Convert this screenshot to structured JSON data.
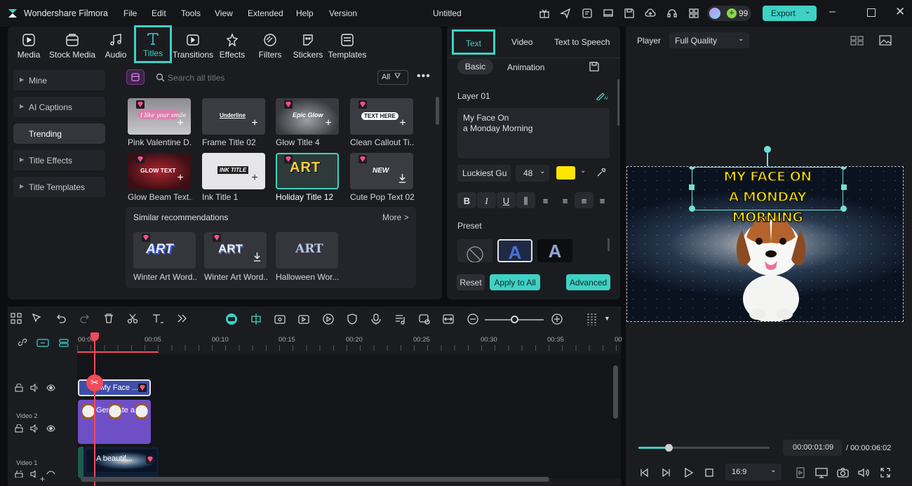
{
  "app": {
    "name": "Wondershare Filmora",
    "doc_title": "Untitled",
    "credits": "99",
    "export_label": "Export"
  },
  "menu": [
    "File",
    "Edit",
    "Tools",
    "View",
    "Extended",
    "Help",
    "Version"
  ],
  "toolbar": [
    "Media",
    "Stock Media",
    "Audio",
    "Titles",
    "Transitions",
    "Effects",
    "Filters",
    "Stickers",
    "Templates"
  ],
  "sidebar": [
    "Mine",
    "AI Captions",
    "Trending",
    "Title Effects",
    "Title Templates"
  ],
  "search": {
    "placeholder": "Search all titles",
    "filter": "All"
  },
  "titles_row1": [
    "Pink Valentine D...",
    "Frame Title 02",
    "Glow Title 4",
    "Clean Callout Ti..."
  ],
  "titles_row2": [
    "Glow Beam Text...",
    "Ink Title 1",
    "Holiday Title 12",
    "Cute Pop Text 02"
  ],
  "thumb_text": {
    "t1": "I like your smile",
    "t2": "Underline",
    "t3": "Epic Glow",
    "t4": "TEXT HERE",
    "t5": "GLOW TEXT",
    "t6": "INK TITLE",
    "t7": "ART",
    "t8": "NEW",
    "s1": "ART",
    "s2": "ART",
    "s3": "ART"
  },
  "similar": {
    "heading": "Similar recommendations",
    "more": "More >",
    "items": [
      "Winter Art Word...",
      "Winter Art Word...",
      "Halloween Wor..."
    ]
  },
  "props": {
    "tabs": [
      "Text",
      "Video",
      "Text to Speech"
    ],
    "subtabs": [
      "Basic",
      "Animation"
    ],
    "layer": "Layer 01",
    "text_line1": "My Face On",
    "text_line2": "a Monday Morning",
    "font": "Luckiest Gu",
    "size": "48",
    "text_color": "#ffe500",
    "preset_label": "Preset",
    "reset": "Reset",
    "apply_all": "Apply to All",
    "advanced": "Advanced"
  },
  "player": {
    "label": "Player",
    "quality": "Full Quality",
    "caption1": "MY FACE ON",
    "caption2": "A MONDAY MORNING",
    "current": "00:00:01:09",
    "total": "/ 00:00:06:02",
    "ratio": "16:9",
    "progress": 0.23
  },
  "timeline": {
    "ruler": [
      "00:00",
      "00:05",
      "00:10",
      "00:15",
      "00:20",
      "00:25",
      "00:30",
      "00:35",
      "00"
    ],
    "tracks": [
      "Video 2",
      "Video 1"
    ],
    "clips": {
      "title": "My Face ...",
      "v2": "Generate a st",
      "v1": "A beautif..."
    }
  },
  "colors": {
    "accent": "#3fd1c4",
    "title_clip": "#3d4ea8",
    "video2_clip": "#6f4fc6",
    "playhead": "#f24a59"
  }
}
